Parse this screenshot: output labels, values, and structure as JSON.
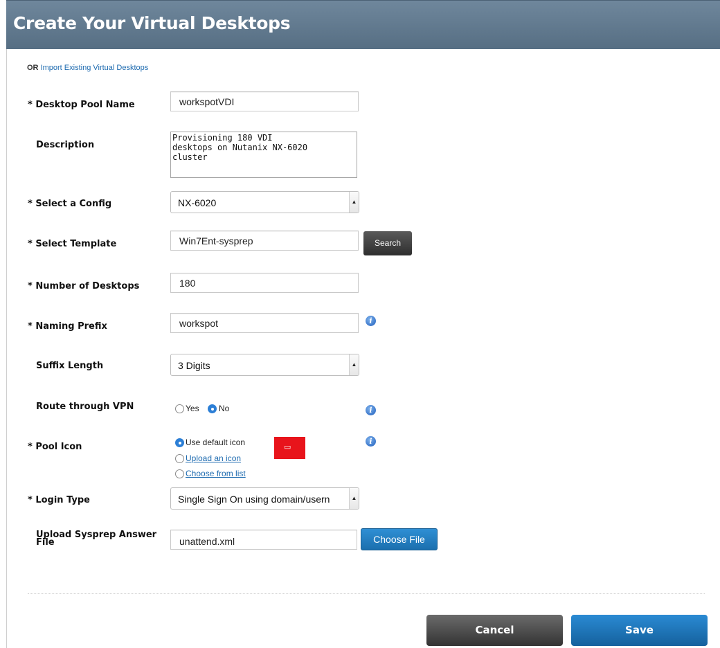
{
  "header": {
    "title": "Create Your Virtual Desktops"
  },
  "import": {
    "or": "OR",
    "link": "Import Existing Virtual Desktops"
  },
  "form": {
    "pool_name": {
      "label": "* Desktop Pool Name",
      "value": "workspotVDI"
    },
    "description": {
      "label": "Description",
      "value": "Provisioning 180 VDI\ndesktops on Nutanix NX-6020\ncluster"
    },
    "config": {
      "label": "* Select a Config",
      "value": "NX-6020"
    },
    "template": {
      "label": "* Select Template",
      "value": "Win7Ent-sysprep",
      "search_label": "Search"
    },
    "num_desktops": {
      "label": "* Number of Desktops",
      "value": "180"
    },
    "naming_prefix": {
      "label": "* Naming Prefix",
      "value": "workspot"
    },
    "suffix_length": {
      "label": "Suffix Length",
      "value": "3 Digits"
    },
    "vpn": {
      "label": "Route through VPN",
      "yes": "Yes",
      "no": "No",
      "selected": "No"
    },
    "pool_icon": {
      "label": "* Pool Icon",
      "default_option": "Use default icon",
      "upload_option": "Upload an icon",
      "choose_option": "Choose from list",
      "selected": "Use default icon",
      "icon_color": "#e8141b"
    },
    "login_type": {
      "label": "* Login Type",
      "value": "Single Sign On using domain/usern"
    },
    "sysprep": {
      "label_line1": "Upload Sysprep Answer",
      "label_line2": "File",
      "value": "unattend.xml",
      "choose_label": "Choose File"
    }
  },
  "actions": {
    "cancel": "Cancel",
    "save": "Save"
  },
  "colors": {
    "header": "#60788d",
    "link": "#1e6bb0",
    "save": "#1e72b5",
    "cancel": "#4a4a4a"
  }
}
